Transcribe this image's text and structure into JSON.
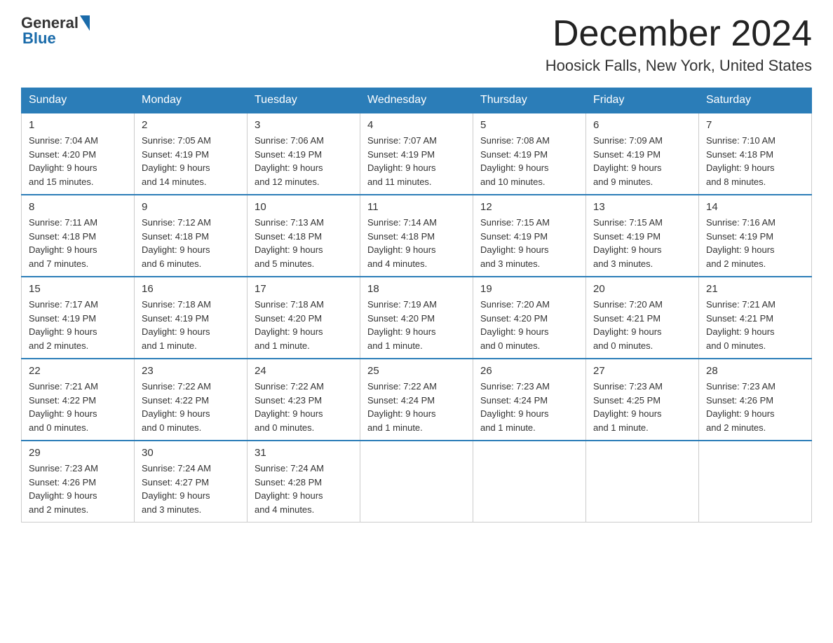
{
  "header": {
    "logo_general": "General",
    "logo_blue": "Blue",
    "month_title": "December 2024",
    "location": "Hoosick Falls, New York, United States"
  },
  "days_of_week": [
    "Sunday",
    "Monday",
    "Tuesday",
    "Wednesday",
    "Thursday",
    "Friday",
    "Saturday"
  ],
  "weeks": [
    [
      {
        "day": "1",
        "sunrise": "7:04 AM",
        "sunset": "4:20 PM",
        "daylight": "9 hours and 15 minutes."
      },
      {
        "day": "2",
        "sunrise": "7:05 AM",
        "sunset": "4:19 PM",
        "daylight": "9 hours and 14 minutes."
      },
      {
        "day": "3",
        "sunrise": "7:06 AM",
        "sunset": "4:19 PM",
        "daylight": "9 hours and 12 minutes."
      },
      {
        "day": "4",
        "sunrise": "7:07 AM",
        "sunset": "4:19 PM",
        "daylight": "9 hours and 11 minutes."
      },
      {
        "day": "5",
        "sunrise": "7:08 AM",
        "sunset": "4:19 PM",
        "daylight": "9 hours and 10 minutes."
      },
      {
        "day": "6",
        "sunrise": "7:09 AM",
        "sunset": "4:19 PM",
        "daylight": "9 hours and 9 minutes."
      },
      {
        "day": "7",
        "sunrise": "7:10 AM",
        "sunset": "4:18 PM",
        "daylight": "9 hours and 8 minutes."
      }
    ],
    [
      {
        "day": "8",
        "sunrise": "7:11 AM",
        "sunset": "4:18 PM",
        "daylight": "9 hours and 7 minutes."
      },
      {
        "day": "9",
        "sunrise": "7:12 AM",
        "sunset": "4:18 PM",
        "daylight": "9 hours and 6 minutes."
      },
      {
        "day": "10",
        "sunrise": "7:13 AM",
        "sunset": "4:18 PM",
        "daylight": "9 hours and 5 minutes."
      },
      {
        "day": "11",
        "sunrise": "7:14 AM",
        "sunset": "4:18 PM",
        "daylight": "9 hours and 4 minutes."
      },
      {
        "day": "12",
        "sunrise": "7:15 AM",
        "sunset": "4:19 PM",
        "daylight": "9 hours and 3 minutes."
      },
      {
        "day": "13",
        "sunrise": "7:15 AM",
        "sunset": "4:19 PM",
        "daylight": "9 hours and 3 minutes."
      },
      {
        "day": "14",
        "sunrise": "7:16 AM",
        "sunset": "4:19 PM",
        "daylight": "9 hours and 2 minutes."
      }
    ],
    [
      {
        "day": "15",
        "sunrise": "7:17 AM",
        "sunset": "4:19 PM",
        "daylight": "9 hours and 2 minutes."
      },
      {
        "day": "16",
        "sunrise": "7:18 AM",
        "sunset": "4:19 PM",
        "daylight": "9 hours and 1 minute."
      },
      {
        "day": "17",
        "sunrise": "7:18 AM",
        "sunset": "4:20 PM",
        "daylight": "9 hours and 1 minute."
      },
      {
        "day": "18",
        "sunrise": "7:19 AM",
        "sunset": "4:20 PM",
        "daylight": "9 hours and 1 minute."
      },
      {
        "day": "19",
        "sunrise": "7:20 AM",
        "sunset": "4:20 PM",
        "daylight": "9 hours and 0 minutes."
      },
      {
        "day": "20",
        "sunrise": "7:20 AM",
        "sunset": "4:21 PM",
        "daylight": "9 hours and 0 minutes."
      },
      {
        "day": "21",
        "sunrise": "7:21 AM",
        "sunset": "4:21 PM",
        "daylight": "9 hours and 0 minutes."
      }
    ],
    [
      {
        "day": "22",
        "sunrise": "7:21 AM",
        "sunset": "4:22 PM",
        "daylight": "9 hours and 0 minutes."
      },
      {
        "day": "23",
        "sunrise": "7:22 AM",
        "sunset": "4:22 PM",
        "daylight": "9 hours and 0 minutes."
      },
      {
        "day": "24",
        "sunrise": "7:22 AM",
        "sunset": "4:23 PM",
        "daylight": "9 hours and 0 minutes."
      },
      {
        "day": "25",
        "sunrise": "7:22 AM",
        "sunset": "4:24 PM",
        "daylight": "9 hours and 1 minute."
      },
      {
        "day": "26",
        "sunrise": "7:23 AM",
        "sunset": "4:24 PM",
        "daylight": "9 hours and 1 minute."
      },
      {
        "day": "27",
        "sunrise": "7:23 AM",
        "sunset": "4:25 PM",
        "daylight": "9 hours and 1 minute."
      },
      {
        "day": "28",
        "sunrise": "7:23 AM",
        "sunset": "4:26 PM",
        "daylight": "9 hours and 2 minutes."
      }
    ],
    [
      {
        "day": "29",
        "sunrise": "7:23 AM",
        "sunset": "4:26 PM",
        "daylight": "9 hours and 2 minutes."
      },
      {
        "day": "30",
        "sunrise": "7:24 AM",
        "sunset": "4:27 PM",
        "daylight": "9 hours and 3 minutes."
      },
      {
        "day": "31",
        "sunrise": "7:24 AM",
        "sunset": "4:28 PM",
        "daylight": "9 hours and 4 minutes."
      },
      null,
      null,
      null,
      null
    ]
  ],
  "labels": {
    "sunrise": "Sunrise:",
    "sunset": "Sunset:",
    "daylight": "Daylight: 9 hours"
  }
}
